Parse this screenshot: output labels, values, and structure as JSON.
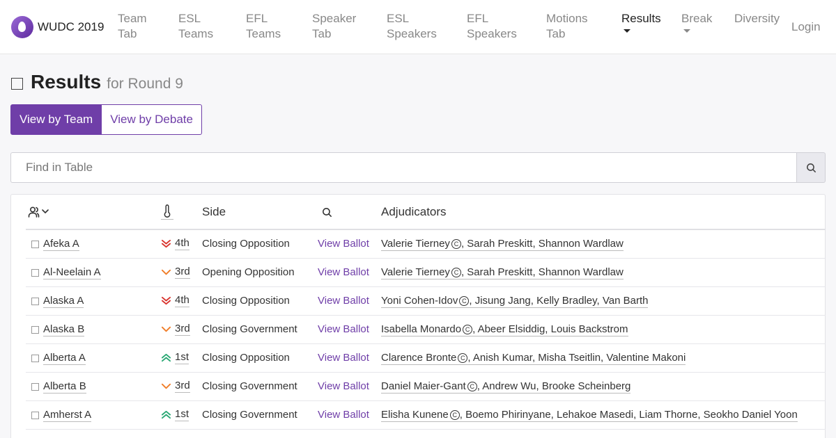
{
  "brand": {
    "name": "WUDC 2019"
  },
  "nav": {
    "team_tab": [
      "Team",
      "Tab"
    ],
    "esl_teams": [
      "ESL",
      "Teams"
    ],
    "efl_teams": [
      "EFL",
      "Teams"
    ],
    "speaker_tab": [
      "Speaker",
      "Tab"
    ],
    "esl_speakers": [
      "ESL",
      "Speakers"
    ],
    "efl_speakers": [
      "EFL",
      "Speakers"
    ],
    "motions_tab": [
      "Motions",
      "Tab"
    ],
    "results": "Results",
    "break": "Break",
    "diversity": "Diversity",
    "login": "Login"
  },
  "header": {
    "title": "Results",
    "subtitle": "for Round 9"
  },
  "view_toggle": {
    "by_team": "View by Team",
    "by_debate": "View by Debate"
  },
  "search": {
    "placeholder": "Find in Table"
  },
  "table": {
    "columns": {
      "side": "Side",
      "adjudicators": "Adjudicators"
    },
    "rows": [
      {
        "team": "Afeka A",
        "result": "4th",
        "trend": "down-double",
        "side": "Closing Opposition",
        "ballot": "View Ballot",
        "chair": "Valerie Tierney",
        "panel": ", Sarah Preskitt, Shannon Wardlaw"
      },
      {
        "team": "Al-Neelain A",
        "result": "3rd",
        "trend": "down",
        "side": "Opening Opposition",
        "ballot": "View Ballot",
        "chair": "Valerie Tierney",
        "panel": ", Sarah Preskitt, Shannon Wardlaw"
      },
      {
        "team": "Alaska A",
        "result": "4th",
        "trend": "down-double",
        "side": "Closing Opposition",
        "ballot": "View Ballot",
        "chair": "Yoni Cohen-Idov",
        "panel": ", Jisung Jang, Kelly Bradley, Van Barth"
      },
      {
        "team": "Alaska B",
        "result": "3rd",
        "trend": "down",
        "side": "Closing Government",
        "ballot": "View Ballot",
        "chair": "Isabella Monardo",
        "panel": ", Abeer Elsiddig, Louis Backstrom"
      },
      {
        "team": "Alberta A",
        "result": "1st",
        "trend": "up-double",
        "side": "Closing Opposition",
        "ballot": "View Ballot",
        "chair": "Clarence Bronte",
        "panel": ", Anish Kumar, Misha Tseitlin, Valentine Makoni"
      },
      {
        "team": "Alberta B",
        "result": "3rd",
        "trend": "down",
        "side": "Closing Government",
        "ballot": "View Ballot",
        "chair": "Daniel Maier-Gant",
        "panel": ", Andrew Wu, Brooke Scheinberg"
      },
      {
        "team": "Amherst A",
        "result": "1st",
        "trend": "up-double",
        "side": "Closing Government",
        "ballot": "View Ballot",
        "chair": "Elisha Kunene",
        "panel": ", Boemo Phirinyane, Lehakoe Masedi, Liam Thorne, Seokho Daniel Yoon"
      }
    ]
  },
  "colors": {
    "accent": "#6f3ea8",
    "down": "#d9352f",
    "down_single": "#f07e2a",
    "up": "#2aa874"
  }
}
